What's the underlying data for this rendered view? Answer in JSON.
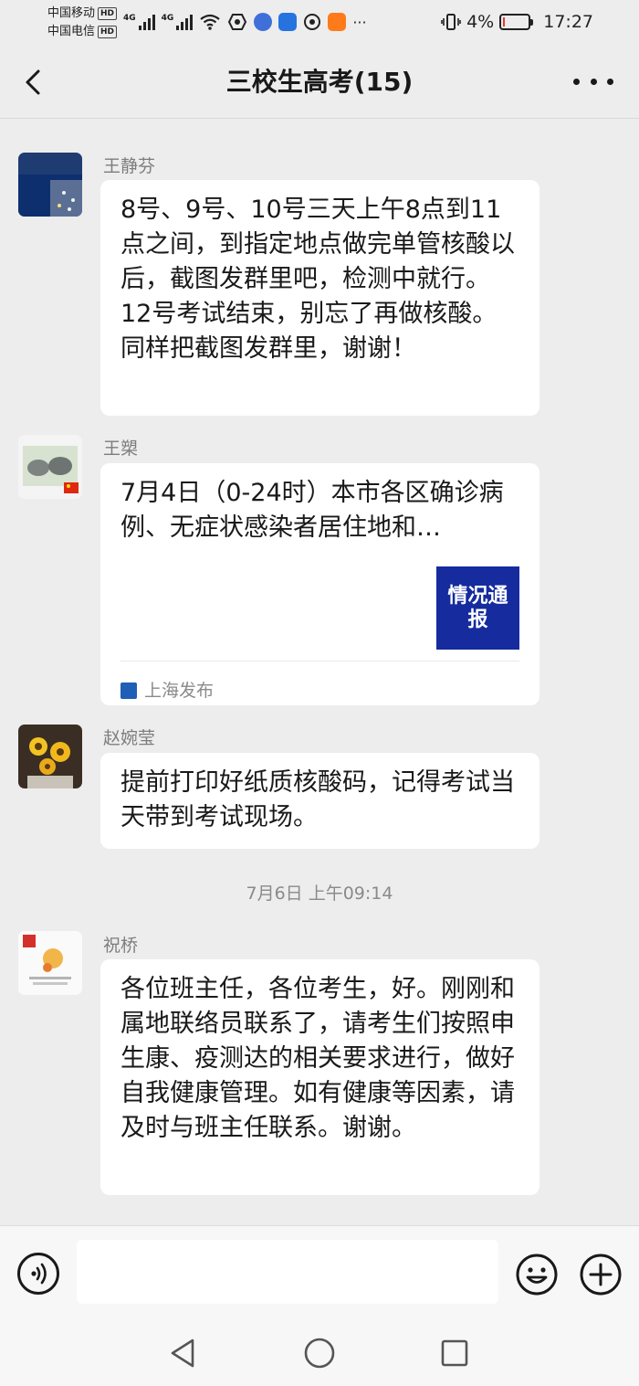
{
  "status_bar": {
    "carrier1": "中国移动",
    "carrier2": "中国电信",
    "hd_badge": "HD",
    "signal_label": "4G",
    "battery_text": "4%",
    "time": "17:27"
  },
  "header": {
    "title": "三校生高考(15)"
  },
  "messages": [
    {
      "sender": "王静芬",
      "text": "8号、9号、10号三天上午8点到11点之间，到指定地点做完单管核酸以后，截图发群里吧，检测中就行。12号考试结束，别忘了再做核酸。同样把截图发群里，谢谢！"
    },
    {
      "sender": "王槊",
      "card_title": "7月4日（0-24时）本市各区确诊病例、无症状感染者居住地和…",
      "card_thumb_text": "情况通报",
      "card_source": "上海发布"
    },
    {
      "sender": "赵婉莹",
      "text": "提前打印好纸质核酸码，记得考试当天带到考试现场。"
    },
    {
      "timestamp": "7月6日 上午09:14"
    },
    {
      "sender": "祝桥",
      "text": "各位班主任，各位考生，好。刚刚和属地联络员联系了，请考生们按照申生康、疫测达的相关要求进行，做好自我健康管理。如有健康等因素，请及时与班主任联系。谢谢。"
    }
  ],
  "input_bar": {
    "placeholder": "",
    "left_icon": "voice-icon",
    "right_icons": [
      "emoji-icon",
      "plus-icon"
    ]
  },
  "nav_bar": {
    "icons": [
      "back-triangle-icon",
      "home-circle-icon",
      "recents-square-icon"
    ]
  },
  "colors": {
    "background": "#ededed",
    "bubble": "#ffffff",
    "card_thumb": "#152b9e",
    "battery_low": "#e53935"
  }
}
